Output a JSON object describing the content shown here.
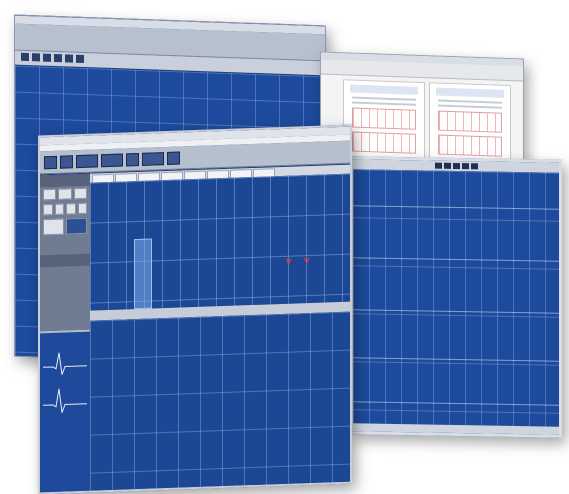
{
  "windows": {
    "main": {
      "title": "",
      "sidebar": {
        "panel_title": "",
        "buttons_row1": [
          "",
          "",
          ""
        ],
        "buttons_row2": [
          "",
          "",
          "",
          ""
        ],
        "buttons_row3": [
          "",
          ""
        ],
        "section_label": "",
        "lead_label": ""
      }
    }
  },
  "colors": {
    "ecg_background": "#1d4a9c",
    "grid_lines": "#a9bee6",
    "chrome": "#b5bfce",
    "marker": "#e23a3a"
  },
  "icons": [
    "toolbar-button-icon",
    "marker-v-icon"
  ]
}
